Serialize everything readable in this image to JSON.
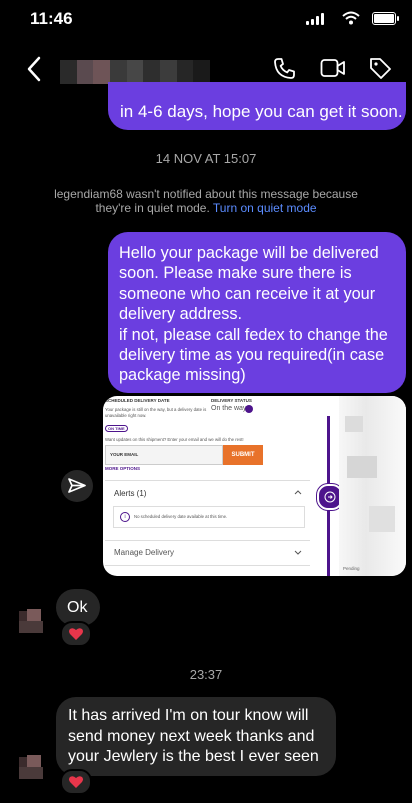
{
  "status": {
    "time": "11:46"
  },
  "messages": {
    "top_outgoing": "in 4-6 days, hope you can get it soon.",
    "timestamp1": "14 NOV AT 15:07",
    "quiet_notice": "legendiam68 wasn't notified about this message because they're in quiet mode.",
    "quiet_link": "Turn on quiet mode",
    "outgoing_lines": [
      "Hello your package will be delivered",
      "soon. Please make sure there is",
      "someone who can receive it at your",
      "delivery address.",
      "if not, please call fedex to change the",
      "delivery time as you required(in case",
      "package missing)"
    ],
    "reply_ok": "Ok",
    "timestamp2": "23:37",
    "incoming_lines": [
      "It has arrived I'm on tour know will",
      "send money next week thanks and",
      "your Jewlery is the best I ever seen"
    ],
    "reaction": "❤️"
  },
  "shared_screenshot": {
    "scheduled_label": "SCHEDULED DELIVERY DATE",
    "scheduled_text": "Your package is still on the way, but a delivery date is unavailable right now.",
    "status_label": "DELIVERY STATUS",
    "status_value": "On the way",
    "on_time_badge": "ON TIME",
    "updates_text": "Want updates on this shipment? Enter your email and we will do the rest!",
    "email_placeholder": "YOUR EMAIL",
    "submit_label": "SUBMIT",
    "more_options": "MORE OPTIONS",
    "alerts_label": "Alerts (1)",
    "alert_text": "No scheduled delivery date available at this time.",
    "manage_label": "Manage Delivery",
    "side_text": "Pending"
  },
  "colors": {
    "outgoing": "#6b3ee0",
    "incoming": "#262626",
    "fedex_orange": "#e8722a",
    "fedex_purple": "#4d148c"
  }
}
